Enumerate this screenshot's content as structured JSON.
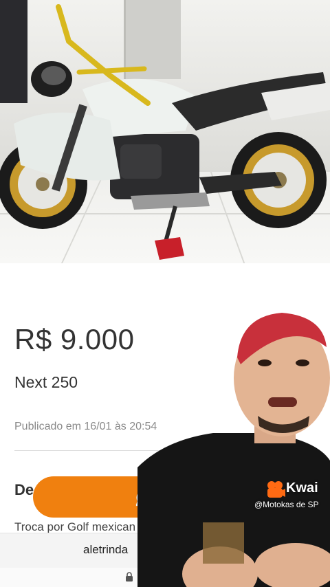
{
  "listing": {
    "price": "R$ 9.000",
    "model": "Next 250",
    "published": "Publicado em 16/01 às 20:54",
    "description_heading": "De",
    "description_text": "Troca por Golf mexican"
  },
  "photo": {
    "subject": "motorcycle-photo"
  },
  "chat": {
    "icon": "chat-bubble-icon",
    "button_color": "#f0800f"
  },
  "browser": {
    "url": "aletrinda",
    "lock_icon": "lock-icon"
  },
  "overlay": {
    "brand": "Kwai",
    "handle": "@Motokas de SP"
  },
  "colors": {
    "accent": "#f0800f",
    "text": "#333333",
    "muted": "#8a8a8a"
  }
}
